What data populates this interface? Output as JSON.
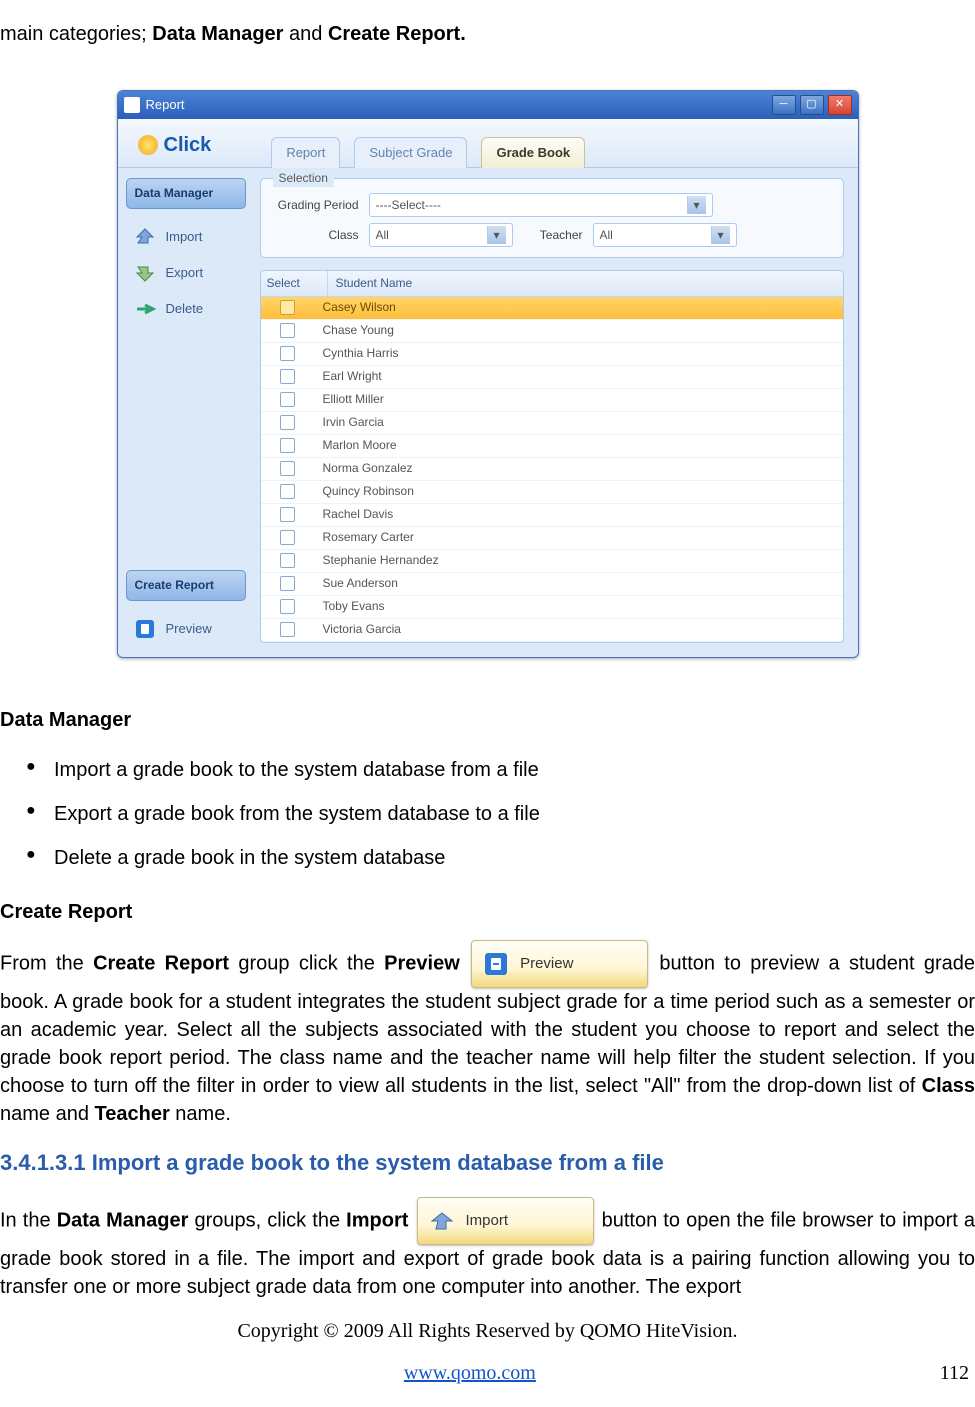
{
  "intro_parts": {
    "pre": "main categories; ",
    "b1": "Data Manager",
    "mid": " and ",
    "b2": "Create Report."
  },
  "window": {
    "title": "Report",
    "brand": "Click",
    "tabs": [
      {
        "label": "Report",
        "active": false
      },
      {
        "label": "Subject Grade",
        "active": false
      },
      {
        "label": "Grade Book",
        "active": true
      }
    ],
    "sidebar": {
      "section1": "Data Manager",
      "items1": [
        {
          "label": "Import"
        },
        {
          "label": "Export"
        },
        {
          "label": "Delete"
        }
      ],
      "section2": "Create Report",
      "items2": [
        {
          "label": "Preview"
        }
      ]
    },
    "selection": {
      "legend": "Selection",
      "grading_label": "Grading Period",
      "grading_value": "----Select----",
      "class_label": "Class",
      "class_value": "All",
      "teacher_label": "Teacher",
      "teacher_value": "All"
    },
    "table": {
      "col_select": "Select",
      "col_name": "Student Name",
      "rows": [
        {
          "name": "Casey Wilson",
          "selected": true
        },
        {
          "name": "Chase Young",
          "selected": false
        },
        {
          "name": "Cynthia Harris",
          "selected": false
        },
        {
          "name": "Earl Wright",
          "selected": false
        },
        {
          "name": "Elliott Miller",
          "selected": false
        },
        {
          "name": "Irvin Garcia",
          "selected": false
        },
        {
          "name": "Marlon Moore",
          "selected": false
        },
        {
          "name": "Norma Gonzalez",
          "selected": false
        },
        {
          "name": "Quincy Robinson",
          "selected": false
        },
        {
          "name": "Rachel Davis",
          "selected": false
        },
        {
          "name": "Rosemary Carter",
          "selected": false
        },
        {
          "name": "Stephanie Hernandez",
          "selected": false
        },
        {
          "name": "Sue Anderson",
          "selected": false
        },
        {
          "name": "Toby Evans",
          "selected": false
        },
        {
          "name": "Victoria Garcia",
          "selected": false
        }
      ]
    }
  },
  "body": {
    "h_dm": "Data Manager",
    "dm_items": [
      "Import a grade book to the system database from a file",
      "Export a grade book from the system database to a file",
      "Delete a grade book in the system database"
    ],
    "h_cr": "Create Report",
    "p1_pre": "From the ",
    "p1_b1": "Create Report",
    "p1_mid1": " group click the ",
    "p1_b2": "Preview",
    "btn_preview": "Preview",
    "p1_post": " button to preview a student grade book. A grade book for a student integrates the student subject grade for a time period such as a semester or an academic year. Select all the subjects associated with the student you choose to report and select the grade book report period. The class name and the teacher name will help filter the student selection. If you choose to turn off the filter in order to view all students in the list, select \"All\" from the drop-down list of ",
    "p1_b3": "Class",
    "p1_mid2": " name and ",
    "p1_b4": "Teacher",
    "p1_end": " name.",
    "h_blue": "3.4.1.3.1  Import a grade book to the system database from a file",
    "p2_pre": "In the ",
    "p2_b1": "Data Manager",
    "p2_mid1": " groups, click the ",
    "p2_b2": "Import",
    "btn_import": "Import",
    "p2_post": " button to open the file browser to import a grade book stored in a file. The import and export of grade book data is a pairing function allowing you to transfer one or more subject grade data from one computer into another. The export",
    "copyright": "Copyright © 2009 All Rights Reserved by QOMO HiteVision.",
    "url": "www.qomo.com",
    "pagenum": "112"
  }
}
